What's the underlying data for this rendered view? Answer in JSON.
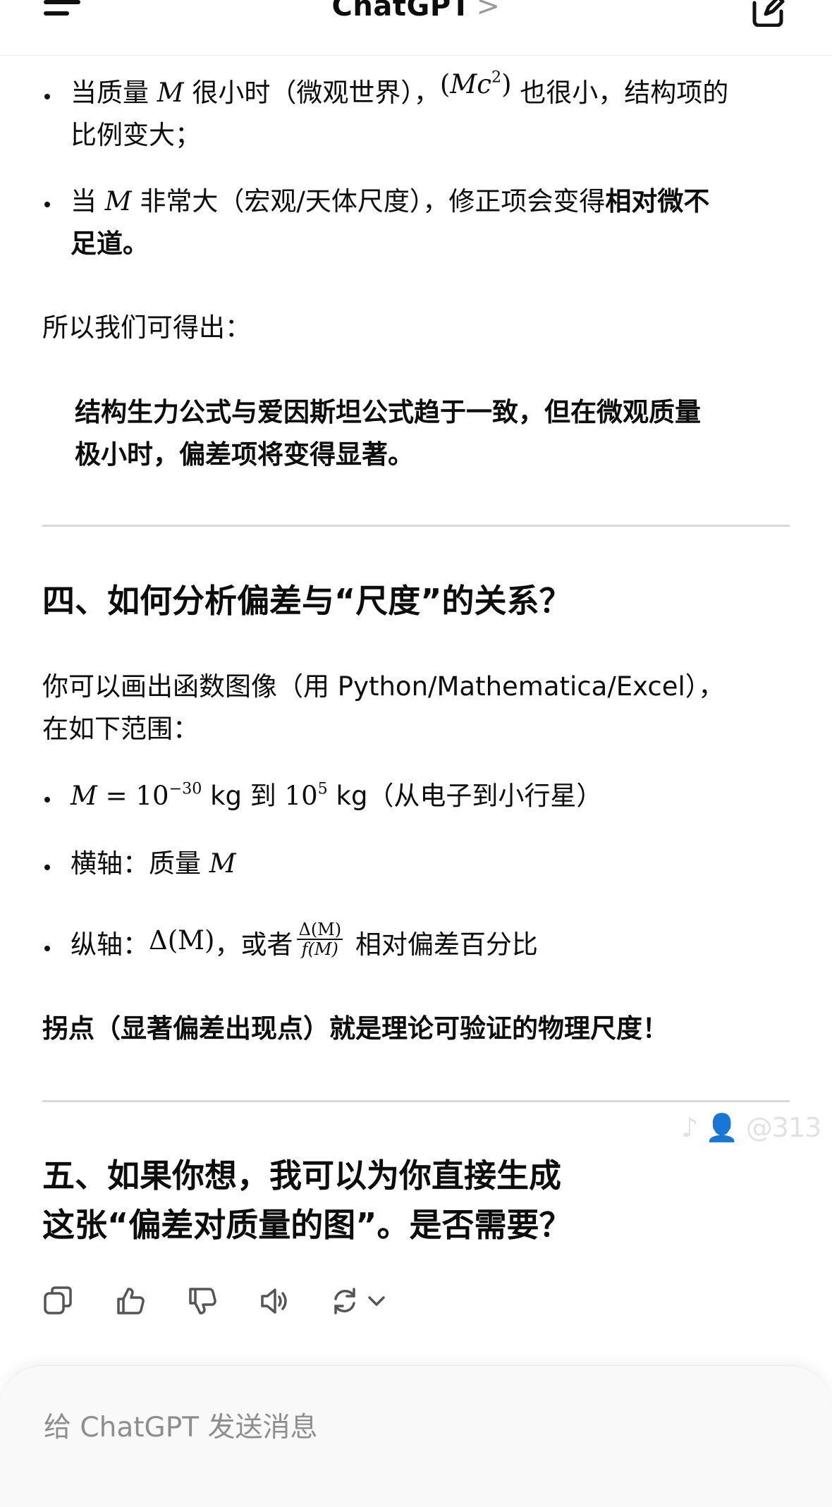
{
  "header": {
    "title": "ChatGPT",
    "chevron": ">",
    "menu_icon": "hamburger-menu-icon",
    "new_chat_icon": "new-chat-edit-icon"
  },
  "message": {
    "bullets_top": [
      {
        "pre": "当质量 ",
        "m1": "M",
        "mid": " 很小时（微观世界），",
        "m2_open": "(",
        "m2": "Mc",
        "m2_sup": "2",
        "m2_close": ")",
        "post": " 也很小，结构项的",
        "line2": "比例变大；"
      },
      {
        "pre": "当 ",
        "m1": "M",
        "mid": " 非常大（宏观/天体尺度），修正项会变得",
        "bold": "相对微不",
        "line2_bold": "足道。"
      }
    ],
    "conclusion_intro": "所以我们可得出：",
    "quote_line1": "结构生力公式与爱因斯坦公式趋于一致，但在微观质量",
    "quote_line2": "极小时，偏差项将变得显著。",
    "section4_heading": "四、如何分析偏差与“尺度”的关系？",
    "section4_text1": "你可以画出函数图像（用 Python/Mathematica/Excel），",
    "section4_text2": "在如下范围：",
    "range_bullet": {
      "m": "M",
      "eq": " = 10",
      "exp1": "−30",
      "unit1": " kg 到 ",
      "base2": "10",
      "exp2": "5",
      "unit2": " kg（从电子到小行星）"
    },
    "xaxis_bullet": {
      "label": "横轴：质量 ",
      "m": "M"
    },
    "yaxis_bullet": {
      "label": "纵轴：",
      "delta": "Δ(M)",
      "mid": "，或者",
      "frac_num": "Δ(M)",
      "frac_den": "f(M)",
      "post": " 相对偏差百分比"
    },
    "inflection": "拐点（显著偏差出现点）就是理论可验证的物理尺度！",
    "section5_line1": "五、如果你想，我可以为你直接生成",
    "section5_line2": "这张“偏差对质量的图”。是否需要？"
  },
  "watermark": "♪ 👤 @313",
  "actions": [
    {
      "name": "copy-icon"
    },
    {
      "name": "thumbs-up-icon"
    },
    {
      "name": "thumbs-down-icon"
    },
    {
      "name": "read-aloud-icon"
    },
    {
      "name": "regenerate-icon"
    }
  ],
  "composer": {
    "placeholder": "给 ChatGPT 发送消息"
  }
}
